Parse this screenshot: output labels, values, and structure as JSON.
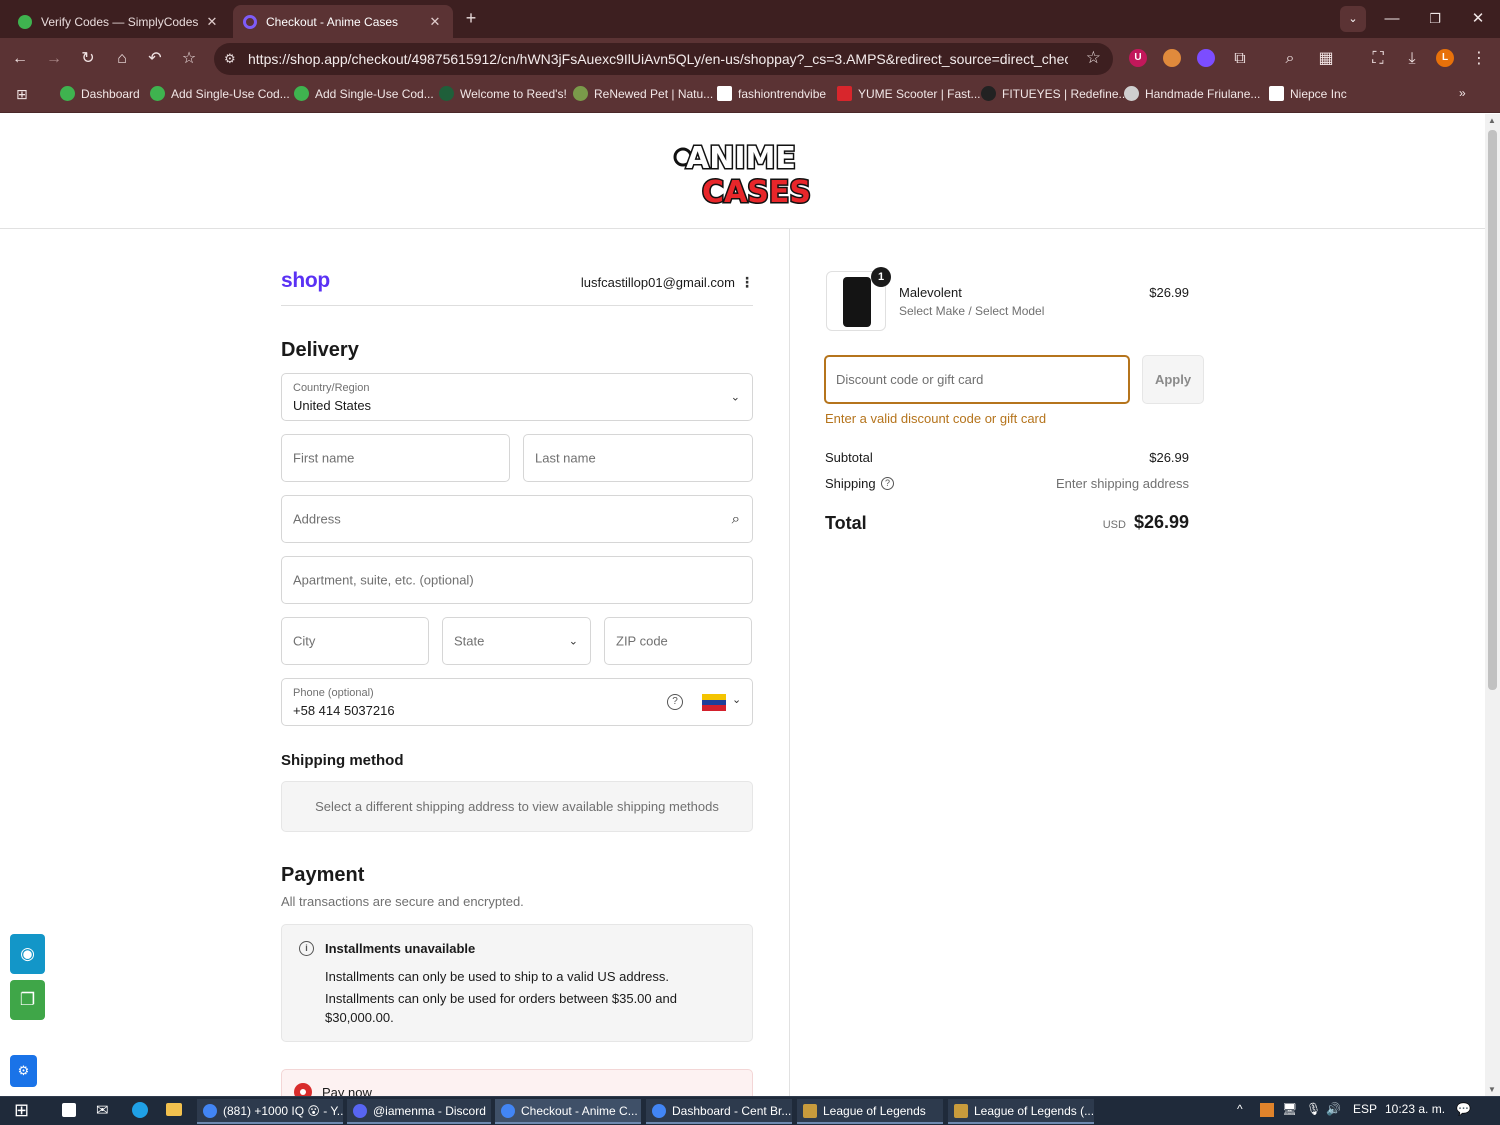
{
  "browser": {
    "tabs": [
      {
        "title": "Verify Codes — SimplyCodes",
        "favicon_color": "#3fb34f"
      },
      {
        "title": "Checkout - Anime Cases",
        "favicon_color": "#6a4cf0"
      }
    ],
    "new_tab_glyph": "+",
    "url": "https://shop.app/checkout/49875615912/cn/hWN3jFsAuexc9IlUiAvn5QLy/en-us/shoppay?_cs=3.AMPS&redirect_source=direct_checkout_pr...",
    "profile_initial": "L",
    "ext_initial": "U",
    "bookmarks": [
      {
        "label": "Dashboard",
        "color": "#3fb34f"
      },
      {
        "label": "Add Single-Use Cod...",
        "color": "#3fb34f"
      },
      {
        "label": "Add Single-Use Cod...",
        "color": "#3fb34f"
      },
      {
        "label": "Welcome to Reed's!",
        "color": "#1f5f3a"
      },
      {
        "label": "ReNewed Pet | Natu...",
        "color": "#7a9a4a"
      },
      {
        "label": "fashiontrendvibe",
        "color": "#ffffff"
      },
      {
        "label": "YUME Scooter | Fast...",
        "color": "#d8262c"
      },
      {
        "label": "FITUEYES | Redefine...",
        "color": "#222222"
      },
      {
        "label": "Handmade Friulane...",
        "color": "#cfcfcf"
      },
      {
        "label": "Niepce Inc",
        "color": "#ffffff"
      }
    ]
  },
  "store": {
    "logo_line1": "ANIME",
    "logo_line2": "CASES"
  },
  "checkout": {
    "shop_brand": "shop",
    "email": "lusfcastillop01@gmail.com",
    "delivery_title": "Delivery",
    "country_label": "Country/Region",
    "country_value": "United States",
    "first_name_ph": "First name",
    "last_name_ph": "Last name",
    "address_ph": "Address",
    "apartment_ph": "Apartment, suite, etc. (optional)",
    "city_ph": "City",
    "state_ph": "State",
    "zip_ph": "ZIP code",
    "phone_label": "Phone (optional)",
    "phone_value": "+58 414 5037216",
    "shipping_method_title": "Shipping method",
    "shipping_method_msg": "Select a different shipping address to view available shipping methods",
    "payment_title": "Payment",
    "payment_subtitle": "All transactions are secure and encrypted.",
    "installments_title": "Installments unavailable",
    "installments_line1": "Installments can only be used to ship to a valid US address.",
    "installments_line2": "Installments can only be used for orders between $35.00 and $30,000.00.",
    "pay_now_label": "Pay now"
  },
  "summary": {
    "product_name": "Malevolent",
    "product_variant": "Select Make / Select Model",
    "product_price": "$26.99",
    "quantity": "1",
    "discount_ph": "Discount code or gift card",
    "apply_label": "Apply",
    "discount_error": "Enter a valid discount code or gift card",
    "subtotal_label": "Subtotal",
    "subtotal_value": "$26.99",
    "shipping_label": "Shipping",
    "shipping_value": "Enter shipping address",
    "total_label": "Total",
    "total_currency": "USD",
    "total_value": "$26.99"
  },
  "taskbar": {
    "items": [
      {
        "label": "(881) +1000 IQ 😮 - Y...",
        "color": "#4285f4"
      },
      {
        "label": "@iamenma - Discord",
        "color": "#5865f2"
      },
      {
        "label": "Checkout - Anime C...",
        "color": "#4285f4"
      },
      {
        "label": "Dashboard - Cent Br...",
        "color": "#4285f4"
      },
      {
        "label": "League of Legends",
        "color": "#c89b3c"
      },
      {
        "label": "League of Legends (...",
        "color": "#c89b3c"
      }
    ],
    "lang": "ESP",
    "clock": "10:23 a. m."
  }
}
